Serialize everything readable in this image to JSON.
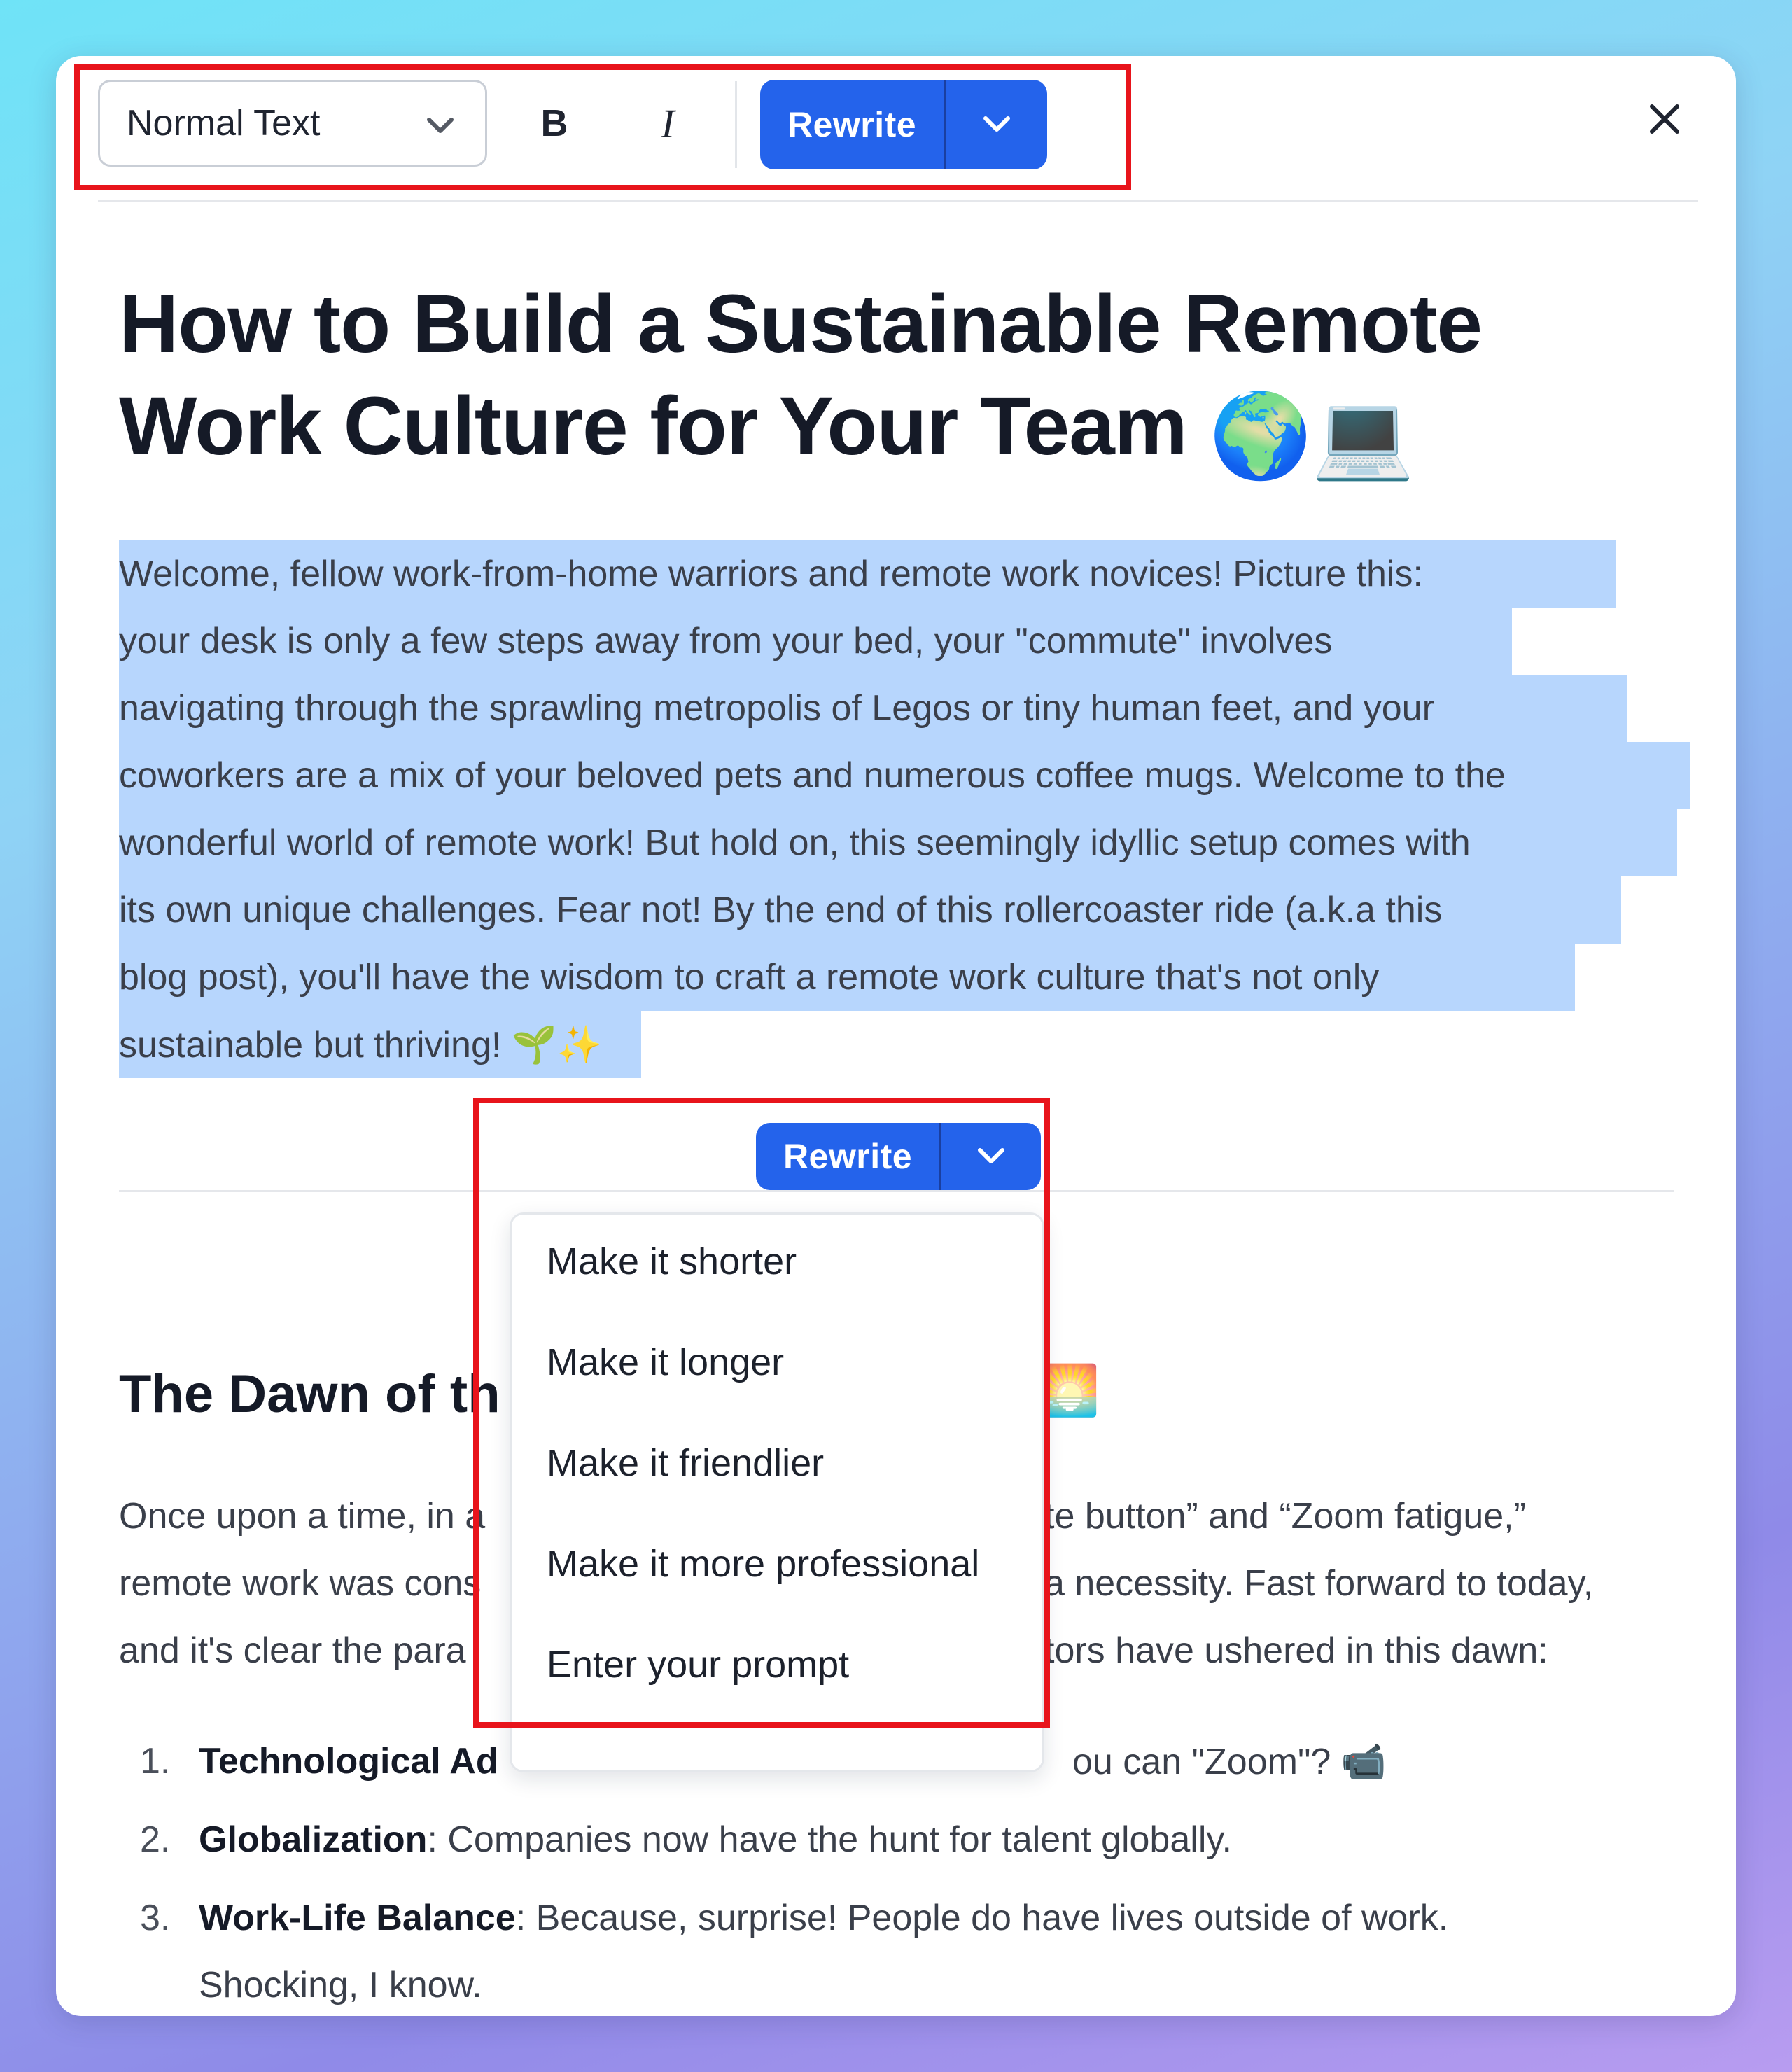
{
  "toolbar": {
    "style_select": "Normal Text",
    "bold_label": "B",
    "italic_label": "I",
    "rewrite_label": "Rewrite",
    "close_label": "×"
  },
  "document": {
    "title_line1": "How to Build a Sustainable Remote",
    "title_line2": "Work Culture for Your Team",
    "title_emoji_globe": "🌍",
    "title_emoji_laptop": "💻",
    "intro_lines": [
      "Welcome, fellow work-from-home warriors and remote work novices! Picture this:",
      "your desk is only a few steps away from your bed, your \"commute\" involves",
      "navigating through the sprawling metropolis of Legos or tiny human feet, and your",
      "coworkers are a mix of your beloved pets and numerous coffee mugs. Welcome to the",
      "wonderful world of remote work! But hold on, this seemingly idyllic setup comes with",
      "its own unique challenges. Fear not! By the end of this rollercoaster ride (a.k.a this",
      "blog post), you'll have the wisdom to craft a remote work culture that's not only",
      "sustainable but thriving! 🌱✨"
    ],
    "section_heading_visible": "The Dawn of th",
    "section_heading_emoji": "🌅",
    "section_lines_left": [
      "Once upon a time, in a",
      "remote work was cons",
      "and it's clear the para"
    ],
    "section_lines_right": [
      "te button” and “Zoom fatigue,”",
      "a necessity. Fast forward to today,",
      "tors have ushered in this dawn:"
    ],
    "list": [
      {
        "num": "1.",
        "bold": "Technological Ad",
        "rest_right": "ou can \"Zoom\"? 📹"
      },
      {
        "num": "2.",
        "bold": "Globalization",
        "rest": ": Companies now have the hunt for talent globally."
      },
      {
        "num": "3.",
        "bold": "Work-Life Balance",
        "rest": ": Because, surprise! People do have lives outside of work.",
        "cont": "Shocking, I know."
      }
    ]
  },
  "inline_rewrite": {
    "label": "Rewrite",
    "menu": [
      "Make it shorter",
      "Make it longer",
      "Make it friendlier",
      "Make it more professional",
      "Enter your prompt"
    ]
  },
  "colors": {
    "accent": "#2463eb",
    "selection": "#b7d6fd",
    "highlight": "#e8141b"
  }
}
